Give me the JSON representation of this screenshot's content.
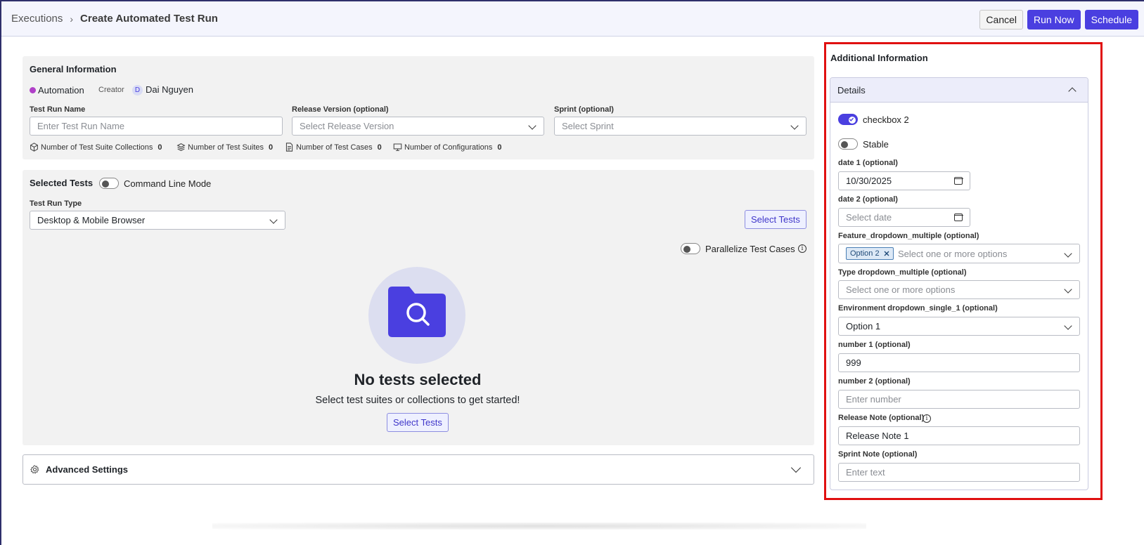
{
  "header": {
    "breadcrumb_root": "Executions",
    "breadcrumb_sep": "›",
    "breadcrumb_current": "Create Automated Test Run",
    "cancel_label": "Cancel",
    "run_now_label": "Run Now",
    "schedule_label": "Schedule"
  },
  "general_info": {
    "title": "General Information",
    "type_label": "Automation",
    "creator_label": "Creator",
    "creator_initial": "D",
    "creator_name": "Dai Nguyen",
    "test_run_name_label": "Test Run Name",
    "test_run_name_placeholder": "Enter Test Run Name",
    "release_version_label": "Release Version (optional)",
    "release_version_placeholder": "Select Release Version",
    "sprint_label": "Sprint (optional)",
    "sprint_placeholder": "Select Sprint",
    "stats": [
      {
        "label": "Number of Test Suite Collections",
        "value": "0"
      },
      {
        "label": "Number of Test Suites",
        "value": "0"
      },
      {
        "label": "Number of Test Cases",
        "value": "0"
      },
      {
        "label": "Number of Configurations",
        "value": "0"
      }
    ]
  },
  "selected_tests": {
    "title": "Selected Tests",
    "command_line_label": "Command Line Mode",
    "test_run_type_label": "Test Run Type",
    "test_run_type_value": "Desktop & Mobile Browser",
    "select_tests_label": "Select Tests",
    "parallelize_label": "Parallelize Test Cases",
    "empty_title": "No tests selected",
    "empty_subtitle": "Select test suites or collections to get started!",
    "empty_button": "Select Tests"
  },
  "advanced": {
    "title": "Advanced Settings"
  },
  "additional": {
    "title": "Additional Information",
    "details_title": "Details",
    "checkbox2_label": "checkbox 2",
    "checkbox2_on": true,
    "stable_label": "Stable",
    "stable_on": false,
    "date1_label": "date 1 (optional)",
    "date1_value": "10/30/2025",
    "date2_label": "date 2 (optional)",
    "date2_placeholder": "Select date",
    "feature_dd_label": "Feature_dropdown_multiple (optional)",
    "feature_dd_chip": "Option 2",
    "feature_dd_placeholder": "Select one or more options",
    "type_dd_label": "Type dropdown_multiple (optional)",
    "type_dd_placeholder": "Select one or more options",
    "env_dd_label": "Environment dropdown_single_1 (optional)",
    "env_dd_value": "Option 1",
    "number1_label": "number 1 (optional)",
    "number1_value": "999",
    "number2_label": "number 2 (optional)",
    "number2_placeholder": "Enter number",
    "release_note_label": "Release Note (optional)",
    "release_note_value": "Release Note 1",
    "sprint_note_label": "Sprint Note (optional)",
    "sprint_note_placeholder": "Enter text"
  },
  "colors": {
    "primary": "#4a3fe0",
    "highlight_outline": "#e01010",
    "automation_dot": "#b040c8"
  }
}
